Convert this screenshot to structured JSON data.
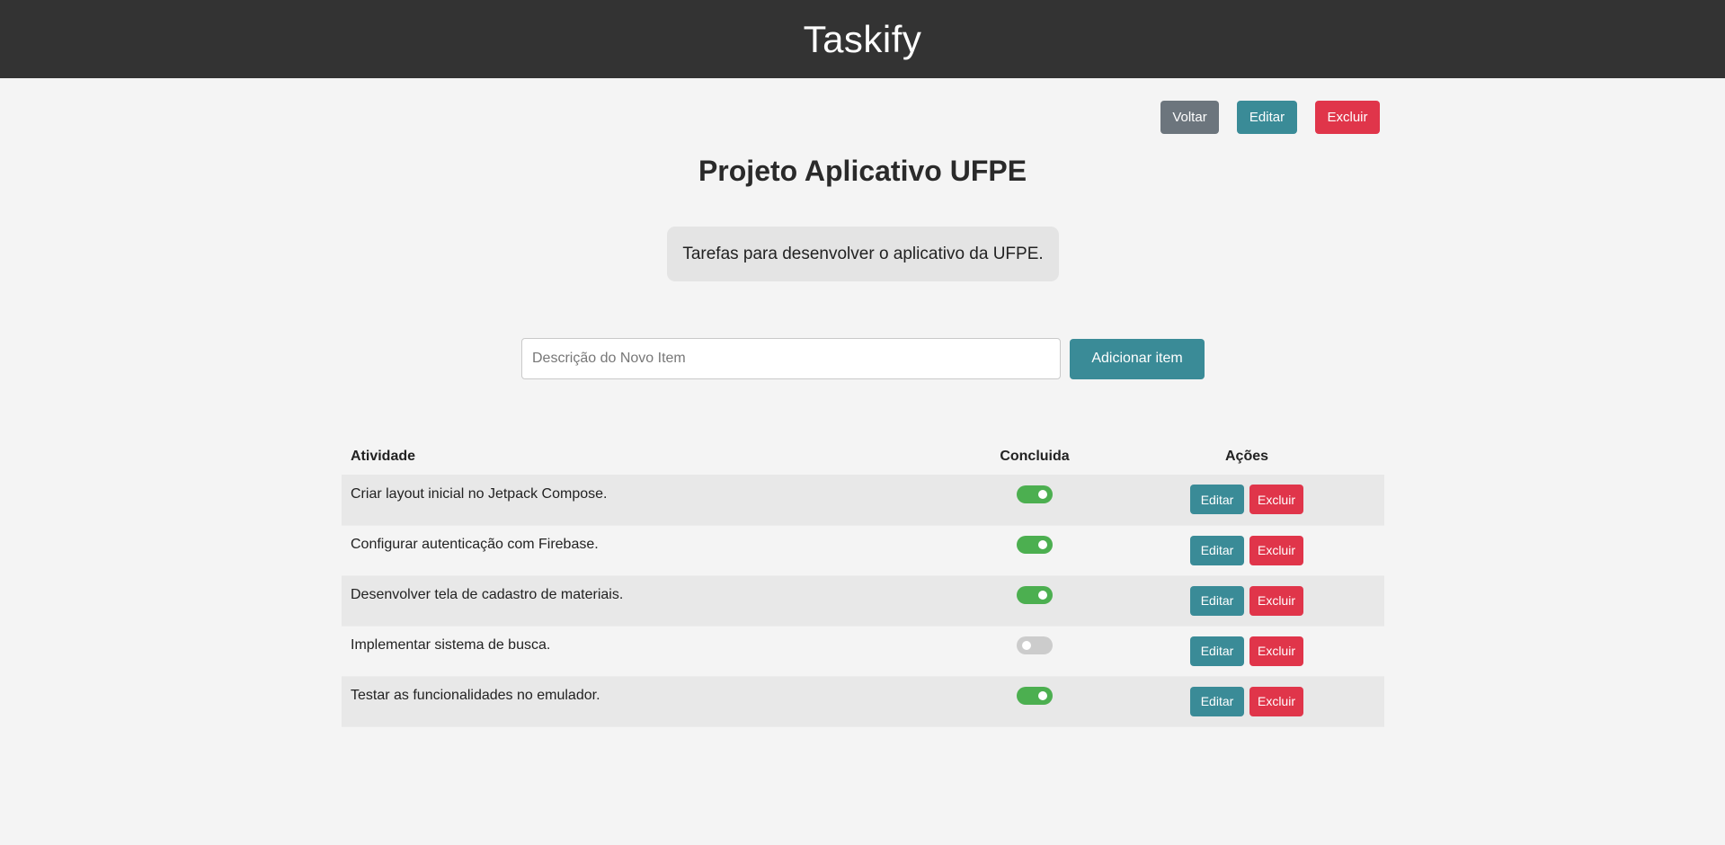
{
  "header": {
    "title": "Taskify"
  },
  "top_actions": {
    "back": "Voltar",
    "edit": "Editar",
    "delete": "Excluir"
  },
  "project": {
    "title": "Projeto Aplicativo UFPE",
    "description": "Tarefas para desenvolver o aplicativo da UFPE."
  },
  "add_item": {
    "placeholder": "Descrição do Novo Item",
    "value": "",
    "button": "Adicionar item"
  },
  "table": {
    "headers": {
      "activity": "Atividade",
      "done": "Concluida",
      "actions": "Ações"
    },
    "rows": [
      {
        "activity": "Criar layout inicial no Jetpack Compose.",
        "done": true,
        "edit": "Editar",
        "delete": "Excluir"
      },
      {
        "activity": "Configurar autenticação com Firebase.",
        "done": true,
        "edit": "Editar",
        "delete": "Excluir"
      },
      {
        "activity": "Desenvolver tela de cadastro de materiais.",
        "done": true,
        "edit": "Editar",
        "delete": "Excluir"
      },
      {
        "activity": "Implementar sistema de busca.",
        "done": false,
        "edit": "Editar",
        "delete": "Excluir"
      },
      {
        "activity": "Testar as funcionalidades no emulador.",
        "done": true,
        "edit": "Editar",
        "delete": "Excluir"
      }
    ]
  },
  "colors": {
    "header_bg": "#333333",
    "teal": "#3a8b97",
    "red": "#e0354a",
    "gray": "#6c757d",
    "toggle_on": "#4caf50",
    "toggle_off": "#cccccc"
  }
}
